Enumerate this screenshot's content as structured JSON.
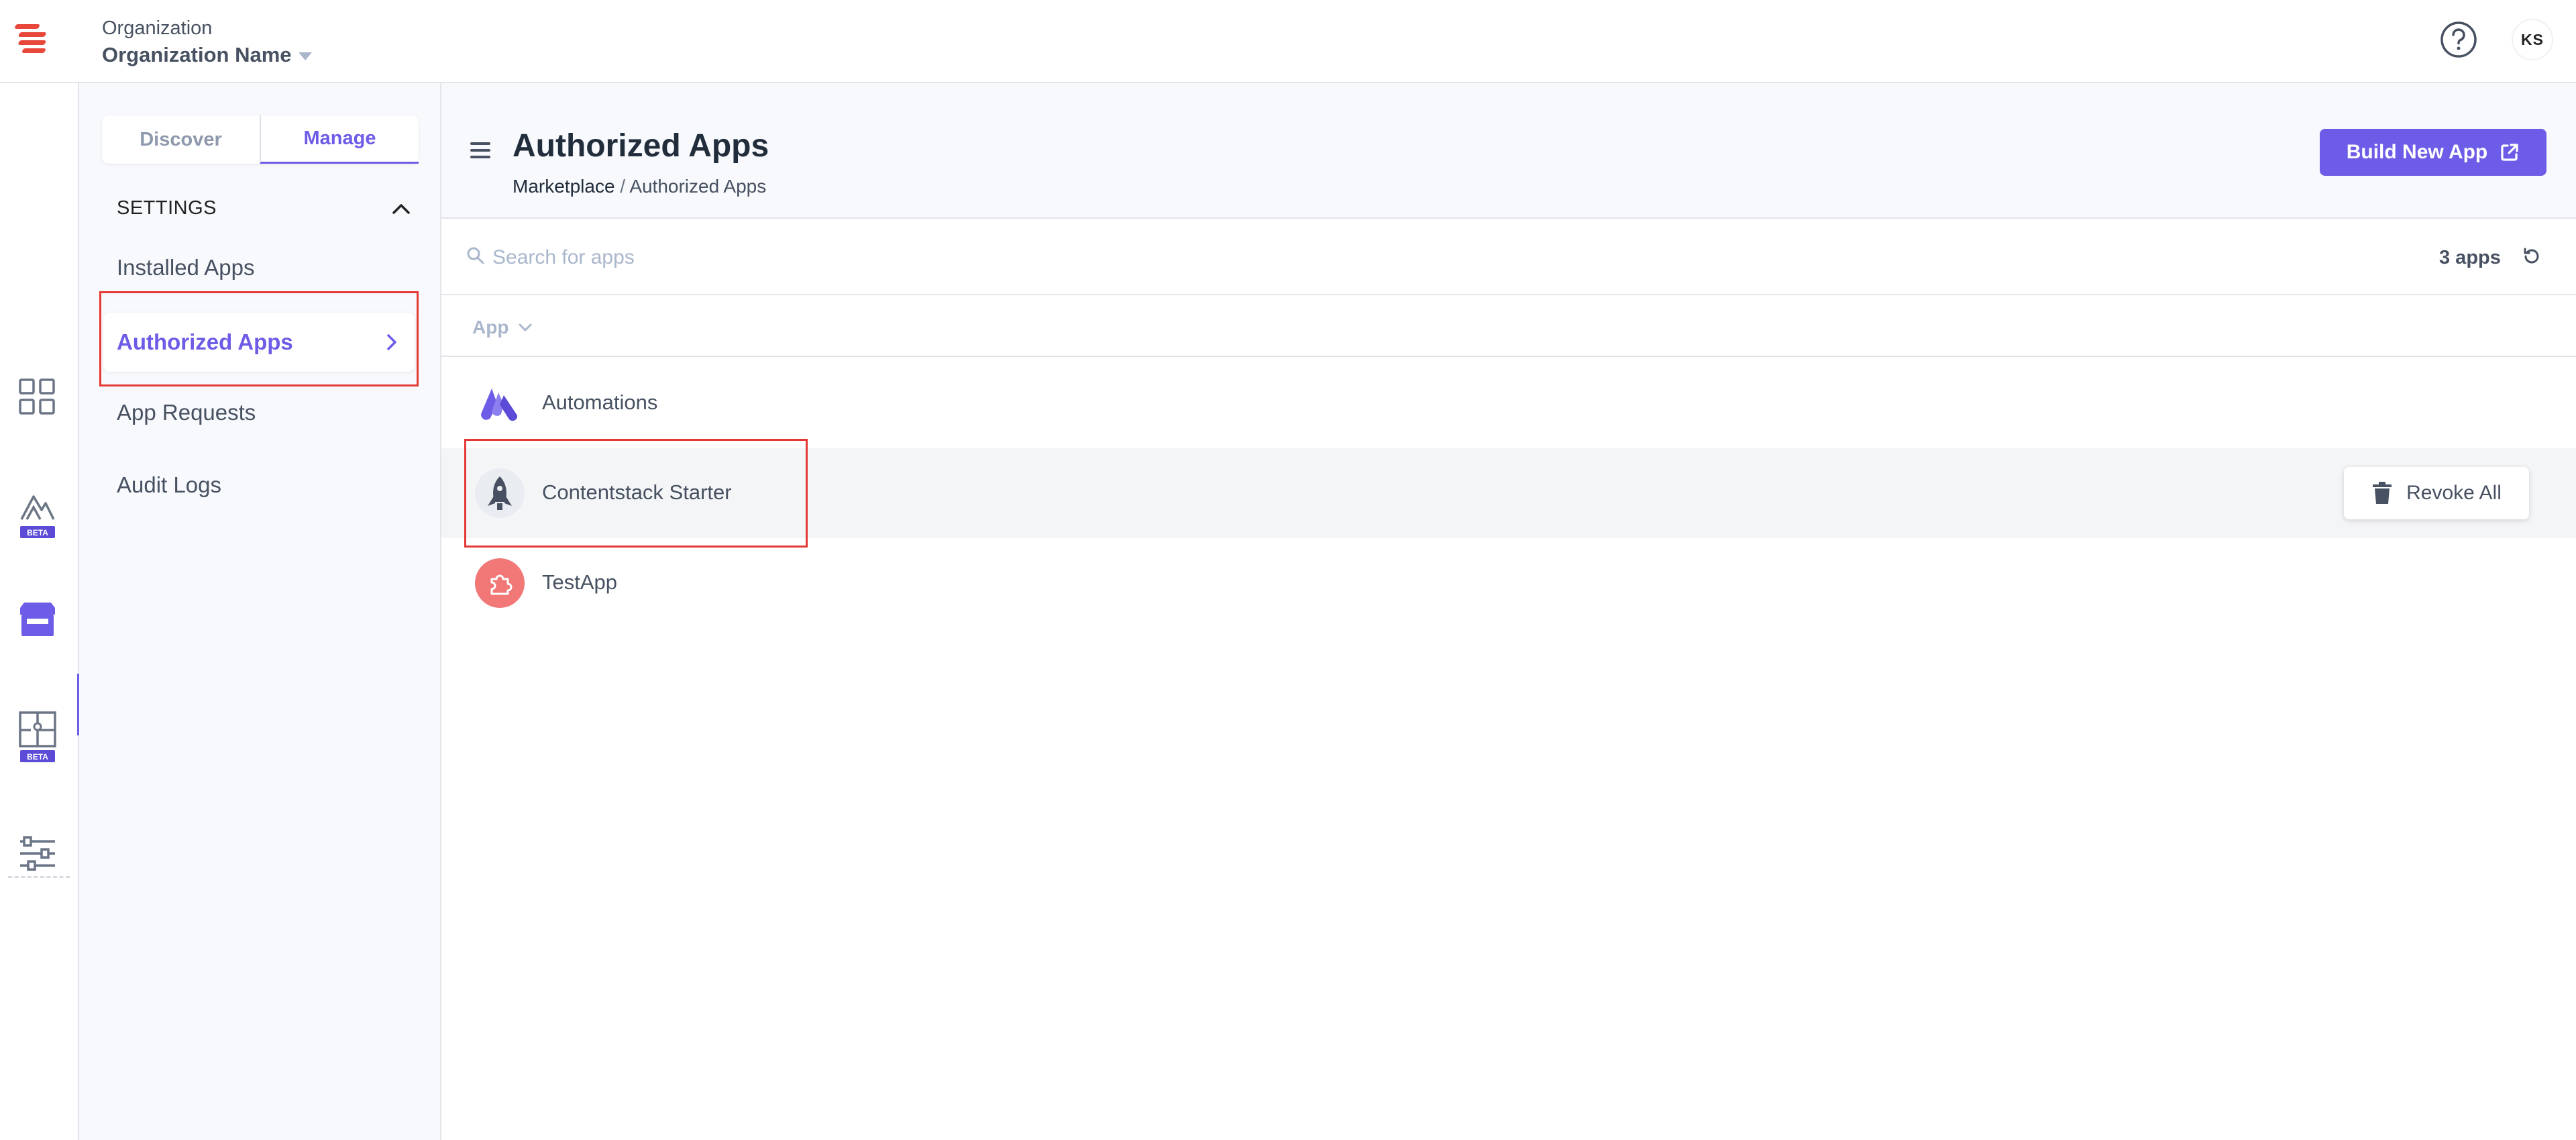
{
  "header": {
    "org_label": "Organization",
    "org_name": "Organization Name",
    "avatar_initials": "KS"
  },
  "rail": {
    "items": [
      {
        "name": "dashboard-grid-icon"
      },
      {
        "name": "automations-beta-icon",
        "badge": "BETA"
      },
      {
        "name": "marketplace-store-icon",
        "active": true
      },
      {
        "name": "puzzle-beta-icon",
        "badge": "BETA"
      },
      {
        "name": "settings-sliders-icon"
      }
    ]
  },
  "subnav": {
    "tabs": [
      {
        "label": "Discover"
      },
      {
        "label": "Manage",
        "active": true
      }
    ],
    "section_title": "SETTINGS",
    "items": [
      {
        "label": "Installed Apps"
      },
      {
        "label": "Authorized Apps",
        "active": true
      },
      {
        "label": "App Requests"
      },
      {
        "label": "Audit Logs"
      }
    ]
  },
  "page": {
    "title": "Authorized Apps",
    "breadcrumb": {
      "root": "Marketplace",
      "sep": "/",
      "current": "Authorized Apps"
    },
    "build_button": "Build New App"
  },
  "search": {
    "placeholder": "Search for apps",
    "count": "3 apps"
  },
  "table": {
    "column": "App",
    "rows": [
      {
        "name": "Automations",
        "icon": "automations-logo-icon",
        "color": "#6c5ce7"
      },
      {
        "name": "Contentstack Starter",
        "icon": "rocket-icon",
        "color": "#475161"
      },
      {
        "name": "TestApp",
        "icon": "puzzle-icon",
        "color": "#f27878"
      }
    ],
    "revoke_label": "Revoke All"
  },
  "colors": {
    "accent": "#6c5ce7",
    "highlight": "#e53935",
    "logo": "#e8473b"
  }
}
